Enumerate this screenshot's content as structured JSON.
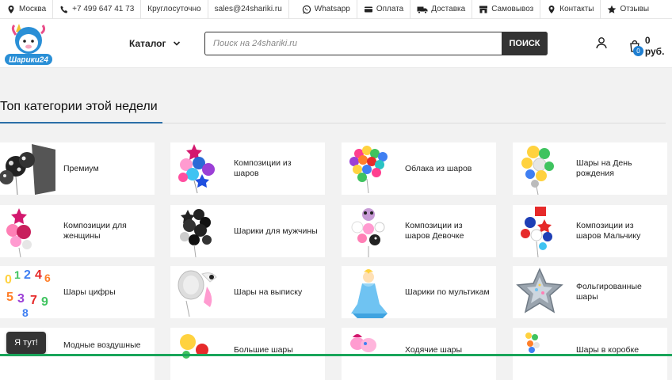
{
  "topbar": {
    "city": "Москва",
    "phone": "+7 499 647 41 73",
    "hours": "Круглосуточно",
    "email": "sales@24shariki.ru",
    "whatsapp": "Whatsapp",
    "payment": "Оплата",
    "delivery": "Доставка",
    "pickup": "Самовывоз",
    "contacts": "Контакты",
    "reviews": "Отзывы"
  },
  "header": {
    "logo_text": "Шарики24",
    "catalog": "Каталог",
    "search_placeholder": "Поиск на 24shariki.ru",
    "search_button": "ПОИСК",
    "cart_count": "0",
    "cart_sum": "0 руб."
  },
  "section": {
    "title": "Топ категории этой недели"
  },
  "categories": [
    {
      "label": "Премиум"
    },
    {
      "label": "Композиции из шаров"
    },
    {
      "label": "Облака из шаров"
    },
    {
      "label": "Шары на День рождения"
    },
    {
      "label": "Композиции для женщины"
    },
    {
      "label": "Шарики для мужчины"
    },
    {
      "label": "Композиции из шаров Девочке"
    },
    {
      "label": "Композиции из шаров Мальчику"
    },
    {
      "label": "Шары цифры"
    },
    {
      "label": "Шары на выписку"
    },
    {
      "label": "Шарики по мультикам"
    },
    {
      "label": "Фольгированные шары"
    },
    {
      "label": "Модные воздушные"
    },
    {
      "label": "Большие шары"
    },
    {
      "label": "Ходячие шары"
    },
    {
      "label": "Шары в коробке"
    }
  ],
  "chat_widget": {
    "label": "Я тут!"
  },
  "colors": {
    "accent": "#2b6fa8",
    "dark_button": "#333333",
    "cart_badge": "#1f7fd1",
    "bottom_bar": "#19a55a"
  }
}
